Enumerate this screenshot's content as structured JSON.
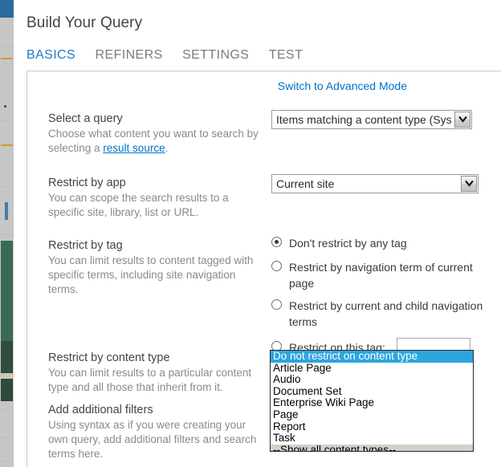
{
  "dialog": {
    "title": "Build Your Query"
  },
  "tabs": [
    {
      "label": "BASICS",
      "active": true
    },
    {
      "label": "REFINERS",
      "active": false
    },
    {
      "label": "SETTINGS",
      "active": false
    },
    {
      "label": "TEST",
      "active": false
    }
  ],
  "panel": {
    "advanced_mode_link": "Switch to Advanced Mode"
  },
  "sections": {
    "select_query": {
      "title": "Select a query",
      "desc_before": "Choose what content you want to search by selecting a ",
      "desc_link": "result source",
      "desc_after": ".",
      "value": "Items matching a content type (System)"
    },
    "restrict_app": {
      "title": "Restrict by app",
      "desc": "You can scope the search results to a specific site, library, list or URL.",
      "value": "Current site"
    },
    "restrict_tag": {
      "title": "Restrict by tag",
      "desc": "You can limit results to content tagged with specific terms, including site navigation terms.",
      "options": [
        {
          "label": "Don't restrict by any tag",
          "checked": true
        },
        {
          "label": "Restrict by navigation term of current page",
          "checked": false
        },
        {
          "label": "Restrict by current and child navigation terms",
          "checked": false
        },
        {
          "label": "Restrict on this tag:",
          "checked": false
        }
      ],
      "tag_value": ""
    },
    "restrict_content_type": {
      "title": "Restrict by content type",
      "desc": "You can limit results to a particular content type and all those that inherit from it.",
      "options": [
        "Do not restrict on content type",
        "Article Page",
        "Audio",
        "Document Set",
        "Enterprise Wiki Page",
        "Page",
        "Report",
        "Task",
        "--Show all content types--"
      ],
      "selected_index": 0,
      "grayed_index": 8
    },
    "additional_filters": {
      "title": "Add additional filters",
      "desc": "Using syntax as if you were creating your own query, add additional filters and search terms here."
    }
  },
  "colors": {
    "accent_blue": "#0072c6",
    "tab_active": "#1e7ac4",
    "list_highlight": "#2ca5dd",
    "backdrop_blue": "#2d6a9f",
    "backdrop_green": "#3a6b52"
  }
}
